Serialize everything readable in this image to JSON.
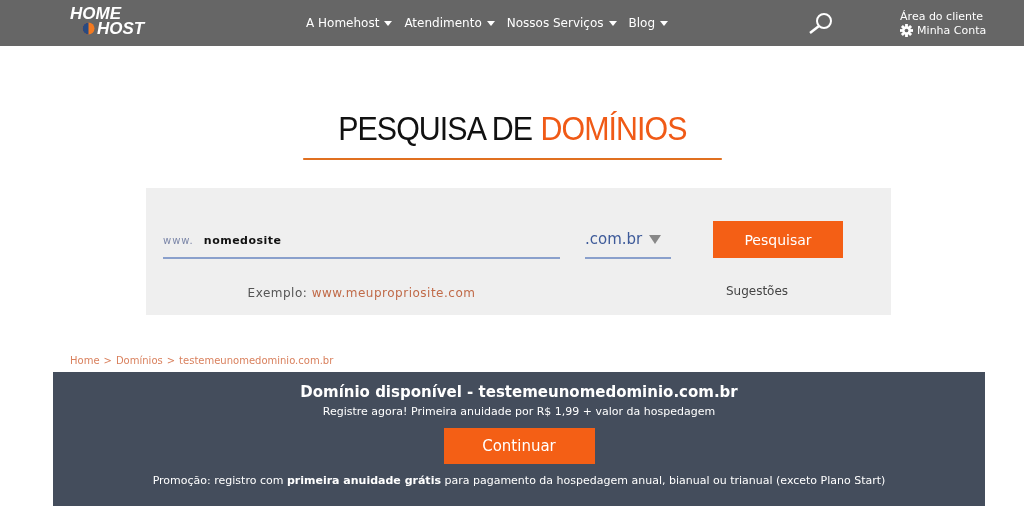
{
  "header": {
    "logo": {
      "line_1": "HOME",
      "line_2": "HOST"
    },
    "nav": [
      {
        "label": "A Homehost"
      },
      {
        "label": "Atendimento"
      },
      {
        "label": "Nossos Serviços"
      },
      {
        "label": "Blog"
      }
    ],
    "account": {
      "caption": "Área do cliente",
      "label": "Minha Conta"
    }
  },
  "title": {
    "prefix": "PESQUISA DE",
    "highlight": "DOMÍNIOS"
  },
  "search": {
    "prefix": "www.",
    "value": "nomedosite",
    "extension": ".com.br",
    "button": "Pesquisar",
    "example_label": "Exemplo:",
    "example_link": "www.meupropriosite.com",
    "suggestions": "Sugestões"
  },
  "breadcrumb": [
    {
      "label": "Home"
    },
    {
      "separator": ">",
      "label": "Domínios"
    },
    {
      "separator": ">",
      "label": "testemeunomedominio.com.br"
    }
  ],
  "result": {
    "heading": "Domínio disponível - testemeunomedominio.com.br",
    "subtitle": "Registre agora! Primeira anuidade por R$ 1,99 + valor da hospedagem",
    "button": "Continuar",
    "promo": "Promoção: registro com **primeira anuidade grátis** para pagamento da hospedagem anual, bianual ou trianual (exceto Plano Start)"
  }
}
